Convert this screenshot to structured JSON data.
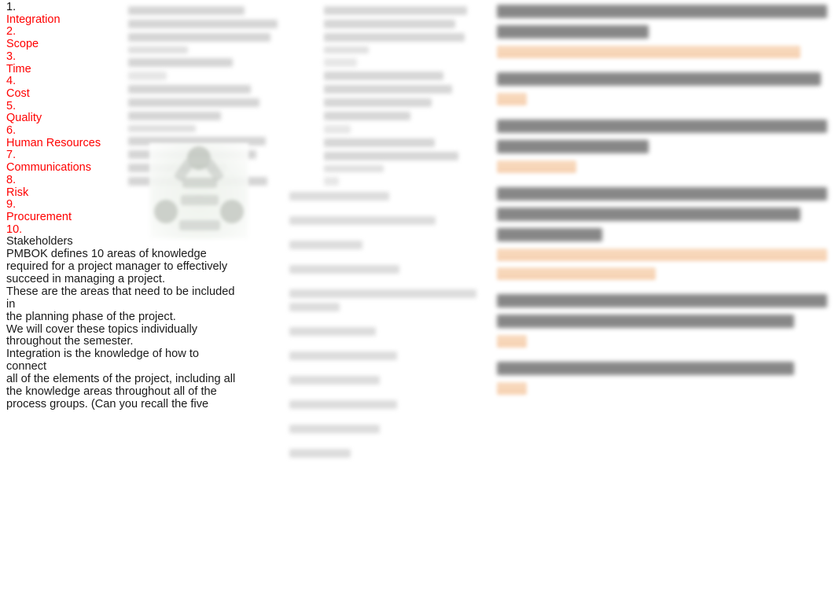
{
  "document": {
    "type": "lecture-slide-notes",
    "background_color": "#ffffff",
    "accent_red": "#ff0000",
    "highlight_peach": "#f8d9bd",
    "blurred_text_color": "#c9c9c9"
  },
  "left_column": {
    "knowledge_areas": [
      {
        "number": "1.",
        "name": "Integration",
        "number_color": "#111111",
        "name_color": "#ff0000"
      },
      {
        "number": "2.",
        "name": "Scope",
        "number_color": "#ff0000",
        "name_color": "#ff0000"
      },
      {
        "number": "3.",
        "name": "Time",
        "number_color": "#ff0000",
        "name_color": "#ff0000"
      },
      {
        "number": "4.",
        "name": "Cost",
        "number_color": "#ff0000",
        "name_color": "#ff0000"
      },
      {
        "number": "5.",
        "name": "Quality",
        "number_color": "#ff0000",
        "name_color": "#ff0000"
      },
      {
        "number": "6.",
        "name": "Human Resources",
        "number_color": "#ff0000",
        "name_color": "#ff0000"
      },
      {
        "number": "7.",
        "name": "Communications",
        "number_color": "#ff0000",
        "name_color": "#ff0000"
      },
      {
        "number": "8.",
        "name": "Risk",
        "number_color": "#ff0000",
        "name_color": "#ff0000"
      },
      {
        "number": "9.",
        "name": "Procurement",
        "number_color": "#ff0000",
        "name_color": "#ff0000"
      },
      {
        "number": "10.",
        "name": "Stakeholders",
        "number_color": "#ff0000",
        "name_color": "#1a1a1a"
      }
    ],
    "paragraph_1": "PMBOK defines 10 areas of knowledge\nrequired for a project manager to effectively\nsucceed in managing a project.",
    "paragraph_2": "These are the areas that need to be included in\nthe planning phase of the project.",
    "paragraph_3": "We will cover these topics individually\nthroughout the semester.",
    "paragraph_4": "Integration is the knowledge of how to connect\nall of the elements of the project, including all\nthe knowledge areas throughout all of the\nprocess groups. (Can you recall the five"
  },
  "middle_column": {
    "top_text_block": {
      "readable": false,
      "description": "blurred paragraph block",
      "line_widths": [
        "78%",
        "100%",
        "95%",
        "40%",
        "70%",
        "26%",
        "82%",
        "88%",
        "62%",
        "45%",
        "92%",
        "86%",
        "66%",
        "93%"
      ]
    },
    "triangle_figure": {
      "readable": false,
      "description": "blurred triangular diagram with circular nodes on pale green background",
      "node_count": 3,
      "bar_count": 3,
      "background_tint": "#eef2ec"
    },
    "list_block": {
      "readable": false,
      "description": "blurred list of short grey text rows",
      "rows": [
        {
          "widths": [
            "52%"
          ]
        },
        {
          "widths": [
            "76%"
          ]
        },
        {
          "widths": [
            "38%"
          ]
        },
        {
          "widths": [
            "57%"
          ]
        },
        {
          "widths": [
            "97%",
            "26%"
          ]
        },
        {
          "widths": [
            "45%"
          ]
        },
        {
          "widths": [
            "56%"
          ]
        },
        {
          "widths": [
            "47%"
          ]
        },
        {
          "widths": [
            "56%"
          ]
        },
        {
          "widths": [
            "47%"
          ]
        },
        {
          "widths": [
            "32%"
          ]
        }
      ]
    }
  },
  "second_column": {
    "top_text_block": {
      "readable": false,
      "description": "blurred paragraph block",
      "line_widths": [
        "96%",
        "88%",
        "94%",
        "30%",
        "22%",
        "80%",
        "86%",
        "72%",
        "58%",
        "18%",
        "74%",
        "90%",
        "40%",
        "10%"
      ]
    }
  },
  "right_column": {
    "questions": [
      {
        "prompt_lines": [
          "100%",
          "46%"
        ],
        "answer_lines": [
          {
            "width": "92%"
          }
        ],
        "readable": false
      },
      {
        "prompt_lines": [
          "98%"
        ],
        "answer_lines": [
          {
            "width": "9%"
          }
        ],
        "readable": false
      },
      {
        "prompt_lines": [
          "100%",
          "46%"
        ],
        "answer_lines": [
          {
            "width": "24%"
          }
        ],
        "readable": false
      },
      {
        "prompt_lines": [
          "100%",
          "92%",
          "32%"
        ],
        "answer_lines": [
          {
            "width": "100%"
          },
          {
            "width": "48%"
          }
        ],
        "readable": false
      },
      {
        "prompt_lines": [
          "100%",
          "90%"
        ],
        "answer_lines": [
          {
            "width": "9%"
          }
        ],
        "readable": false
      },
      {
        "prompt_lines": [
          "90%"
        ],
        "answer_lines": [
          {
            "width": "9%"
          }
        ],
        "readable": false
      }
    ]
  }
}
